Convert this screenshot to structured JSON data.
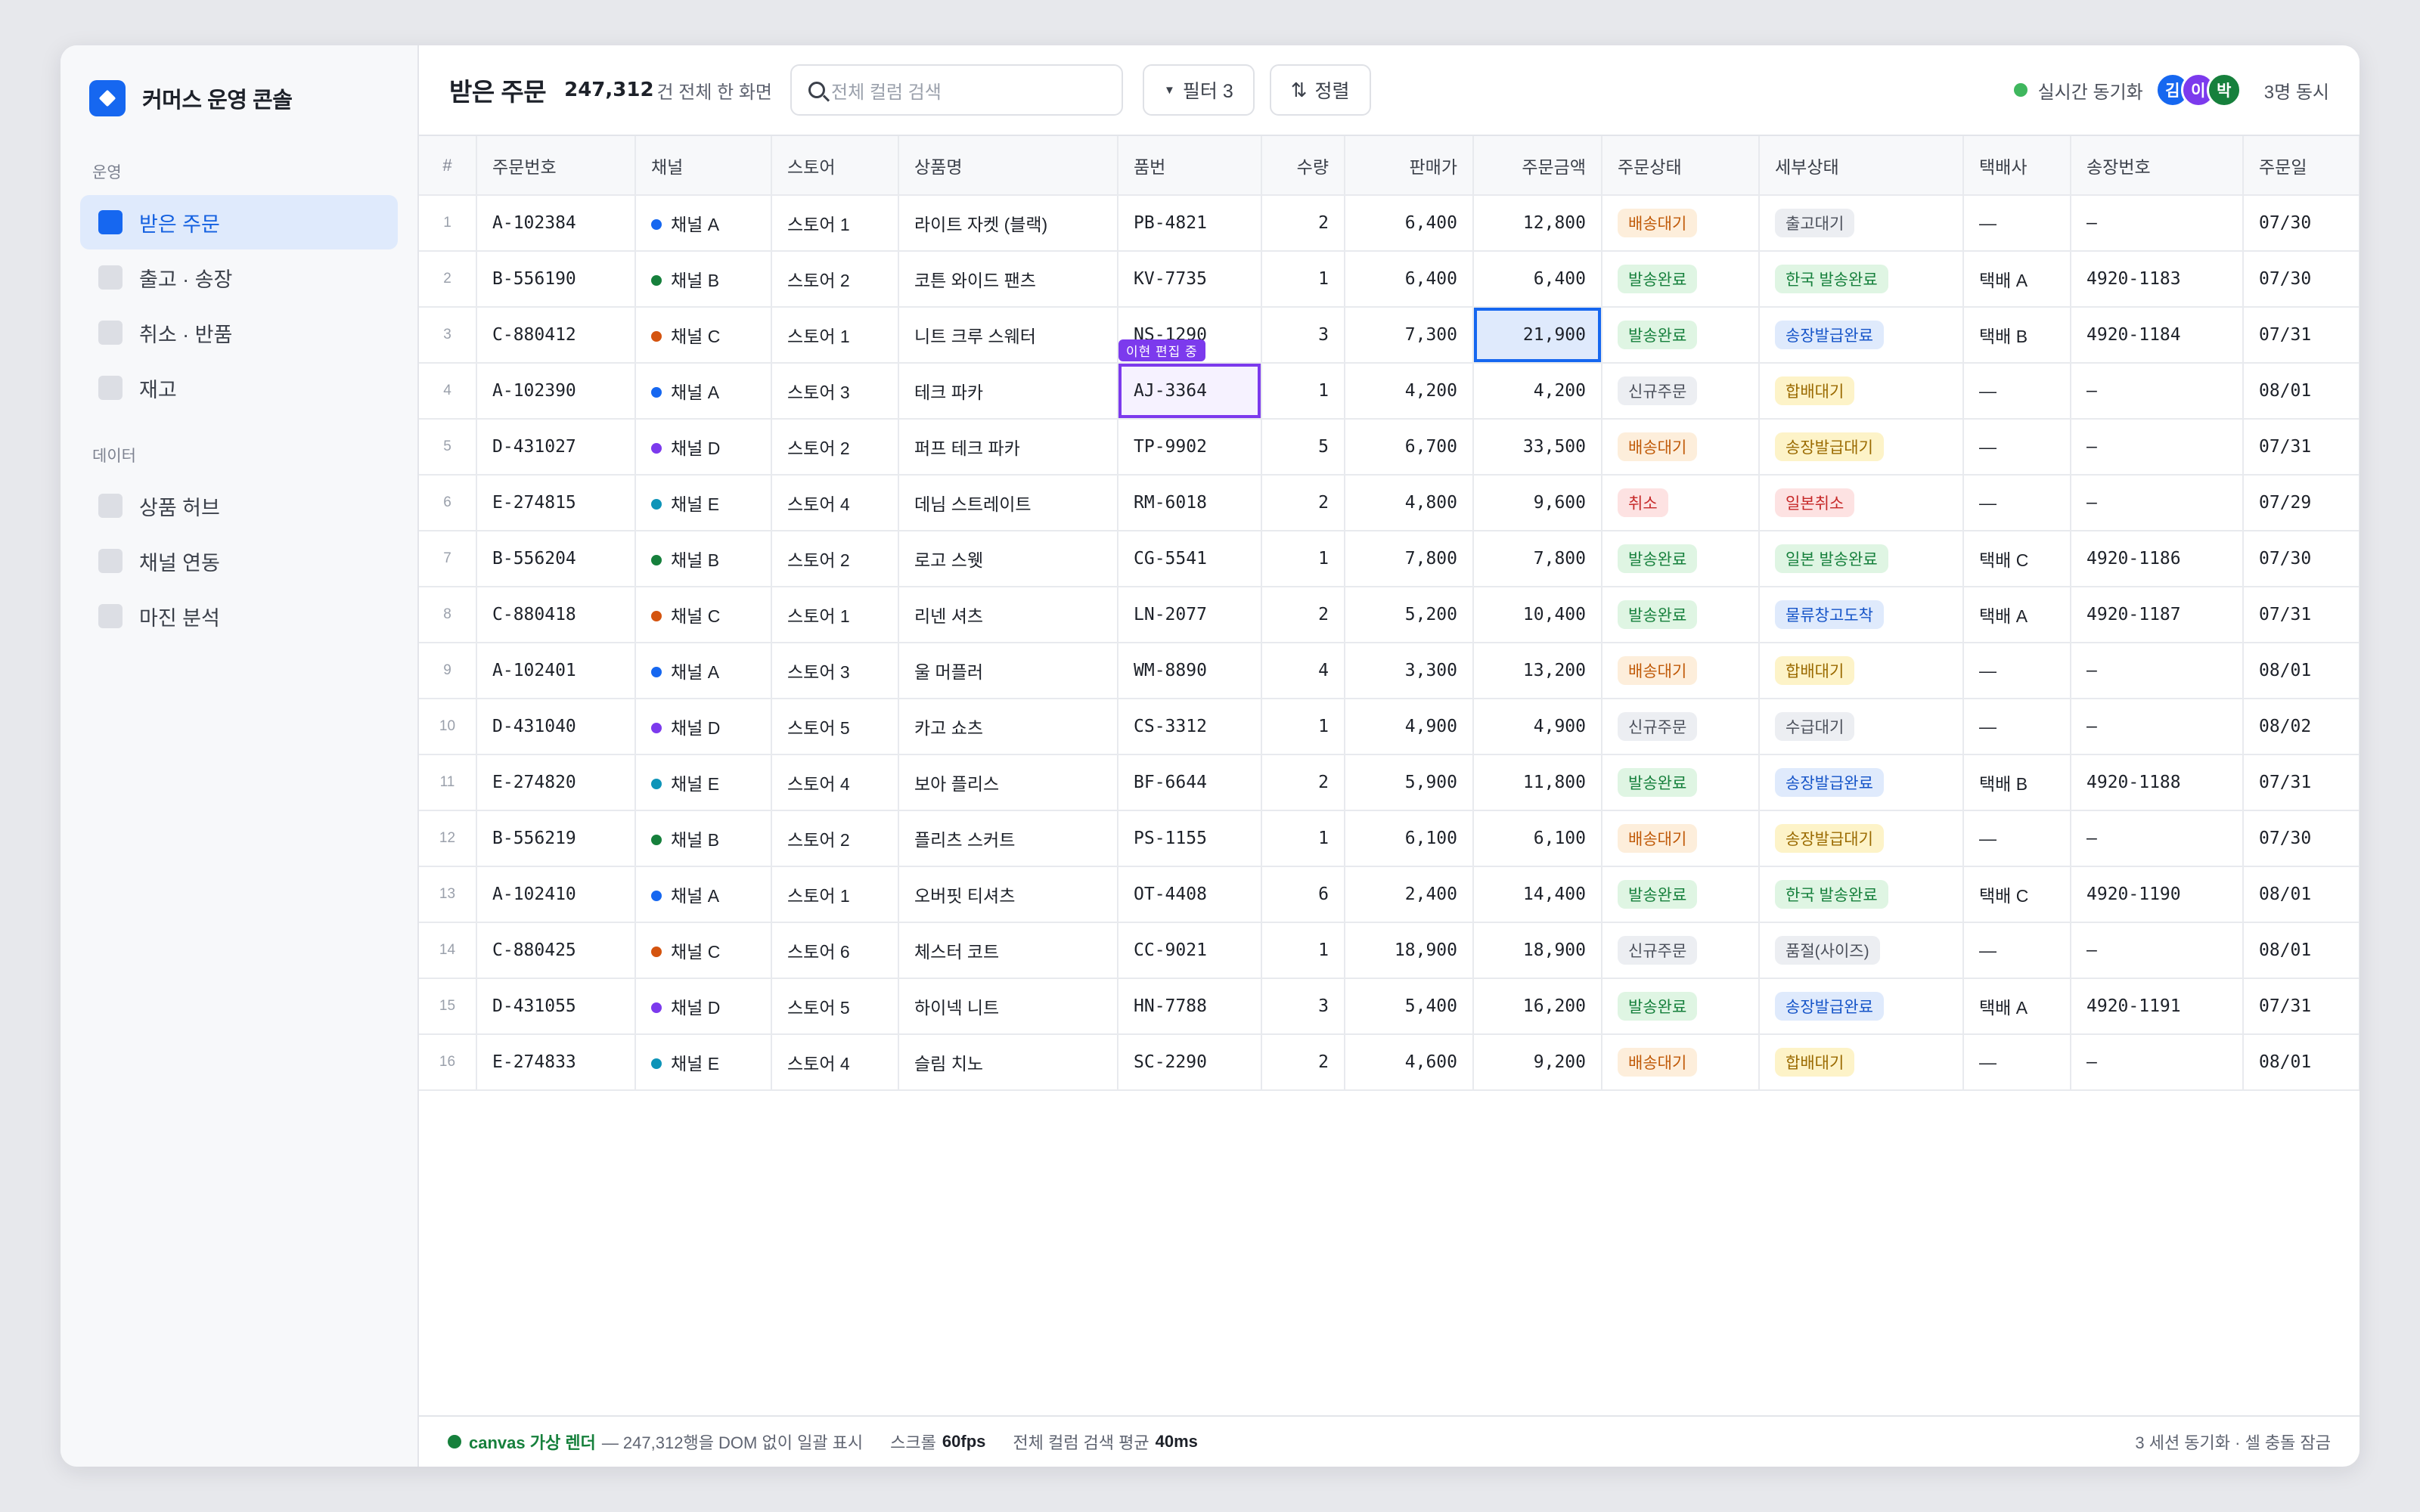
{
  "sidebar": {
    "brand": "커머스 운영 콘솔",
    "section_ops": "운영",
    "section_data": "데이터",
    "ops_items": [
      "받은 주문",
      "출고 · 송장",
      "취소 · 반품",
      "재고"
    ],
    "data_items": [
      "상품 허브",
      "채널 연동",
      "마진 분석"
    ]
  },
  "toolbar": {
    "title": "받은 주문",
    "count": "247,312",
    "count_label": "건 전체 한 화면",
    "search_placeholder": "전체 컬럼 검색",
    "filter_label": "필터 3",
    "sort_label": "정렬",
    "sync_label": "실시간 동기화",
    "avatars": [
      "김",
      "이",
      "박"
    ],
    "concurrent": "3명 동시"
  },
  "table": {
    "columns": [
      "#",
      "주문번호",
      "채널",
      "스토어",
      "상품명",
      "품번",
      "수량",
      "판매가",
      "주문금액",
      "주문상태",
      "세부상태",
      "택배사",
      "송장번호",
      "주문일"
    ],
    "edit_tag": "이현 편집 중",
    "rows": [
      [
        "1",
        "A-102384",
        "채널 A",
        "스토어 1",
        "라이트 자켓 (블랙)",
        "PB-4821",
        "2",
        "6,400",
        "12,800",
        "배송대기",
        "출고대기",
        "—",
        "—",
        "07/30"
      ],
      [
        "2",
        "B-556190",
        "채널 B",
        "스토어 2",
        "코튼 와이드 팬츠",
        "KV-7735",
        "1",
        "6,400",
        "6,400",
        "발송완료",
        "한국 발송완료",
        "택배 A",
        "4920-1183",
        "07/30"
      ],
      [
        "3",
        "C-880412",
        "채널 C",
        "스토어 1",
        "니트 크루 스웨터",
        "NS-1290",
        "3",
        "7,300",
        "21,900",
        "발송완료",
        "송장발급완료",
        "택배 B",
        "4920-1184",
        "07/31"
      ],
      [
        "4",
        "A-102390",
        "채널 A",
        "스토어 3",
        "테크 파카",
        "AJ-3364",
        "1",
        "4,200",
        "4,200",
        "신규주문",
        "합배대기",
        "—",
        "—",
        "08/01"
      ],
      [
        "5",
        "D-431027",
        "채널 D",
        "스토어 2",
        "퍼프 테크 파카",
        "TP-9902",
        "5",
        "6,700",
        "33,500",
        "배송대기",
        "송장발급대기",
        "—",
        "—",
        "07/31"
      ],
      [
        "6",
        "E-274815",
        "채널 E",
        "스토어 4",
        "데님 스트레이트",
        "RM-6018",
        "2",
        "4,800",
        "9,600",
        "취소",
        "일본취소",
        "—",
        "—",
        "07/29"
      ],
      [
        "7",
        "B-556204",
        "채널 B",
        "스토어 2",
        "로고 스웻",
        "CG-5541",
        "1",
        "7,800",
        "7,800",
        "발송완료",
        "일본 발송완료",
        "택배 C",
        "4920-1186",
        "07/30"
      ],
      [
        "8",
        "C-880418",
        "채널 C",
        "스토어 1",
        "리넨 셔츠",
        "LN-2077",
        "2",
        "5,200",
        "10,400",
        "발송완료",
        "물류창고도착",
        "택배 A",
        "4920-1187",
        "07/31"
      ],
      [
        "9",
        "A-102401",
        "채널 A",
        "스토어 3",
        "울 머플러",
        "WM-8890",
        "4",
        "3,300",
        "13,200",
        "배송대기",
        "합배대기",
        "—",
        "—",
        "08/01"
      ],
      [
        "10",
        "D-431040",
        "채널 D",
        "스토어 5",
        "카고 쇼츠",
        "CS-3312",
        "1",
        "4,900",
        "4,900",
        "신규주문",
        "수급대기",
        "—",
        "—",
        "08/02"
      ],
      [
        "11",
        "E-274820",
        "채널 E",
        "스토어 4",
        "보아 플리스",
        "BF-6644",
        "2",
        "5,900",
        "11,800",
        "발송완료",
        "송장발급완료",
        "택배 B",
        "4920-1188",
        "07/31"
      ],
      [
        "12",
        "B-556219",
        "채널 B",
        "스토어 2",
        "플리츠 스커트",
        "PS-1155",
        "1",
        "6,100",
        "6,100",
        "배송대기",
        "송장발급대기",
        "—",
        "—",
        "07/30"
      ],
      [
        "13",
        "A-102410",
        "채널 A",
        "스토어 1",
        "오버핏 티셔츠",
        "OT-4408",
        "6",
        "2,400",
        "14,400",
        "발송완료",
        "한국 발송완료",
        "택배 C",
        "4920-1190",
        "08/01"
      ],
      [
        "14",
        "C-880425",
        "채널 C",
        "스토어 6",
        "체스터 코트",
        "CC-9021",
        "1",
        "18,900",
        "18,900",
        "신규주문",
        "품절(사이즈)",
        "—",
        "—",
        "08/01"
      ],
      [
        "15",
        "D-431055",
        "채널 D",
        "스토어 5",
        "하이넥 니트",
        "HN-7788",
        "3",
        "5,400",
        "16,200",
        "발송완료",
        "송장발급완료",
        "택배 A",
        "4920-1191",
        "07/31"
      ],
      [
        "16",
        "E-274833",
        "채널 E",
        "스토어 4",
        "슬림 치노",
        "SC-2290",
        "2",
        "4,600",
        "9,200",
        "배송대기",
        "합배대기",
        "—",
        "—",
        "08/01"
      ]
    ]
  },
  "channel_colors": {
    "채널 A": "#1667f0",
    "채널 B": "#16803c",
    "채널 C": "#d4540f",
    "채널 D": "#7c3aed",
    "채널 E": "#0e94b8"
  },
  "status_colors": {
    "배송대기": "b-orange",
    "발송완료": "b-green",
    "신규주문": "b-gray",
    "취소": "b-red",
    "출고대기": "b-gray",
    "한국 발송완료": "b-green",
    "송장발급완료": "b-blue",
    "합배대기": "b-yellow",
    "송장발급대기": "b-yellow",
    "일본취소": "b-red",
    "일본 발송완료": "b-green",
    "물류창고도착": "b-blue",
    "수급대기": "b-gray",
    "품절(사이즈)": "b-gray"
  },
  "footer": {
    "render_label": "canvas 가상 렌더",
    "render_desc": "— 247,312행을 DOM 없이 일괄 표시",
    "scroll_label": "스크롤",
    "scroll_value": "60fps",
    "search_label": "전체 컬럼 검색 평균",
    "search_value": "40ms",
    "right": "3 세션 동기화 · 셀 충돌 잠금"
  }
}
